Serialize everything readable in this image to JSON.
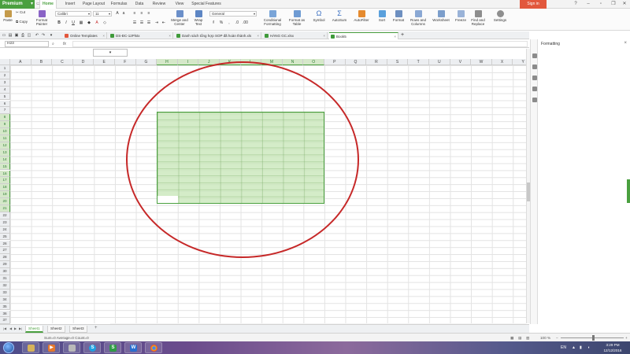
{
  "menubar": {
    "premium_label": "Premium",
    "tabs": [
      "Home",
      "Insert",
      "Page Layout",
      "Formulas",
      "Data",
      "Review",
      "View",
      "Special Features"
    ],
    "active_tab": "Home",
    "signin_label": "Sign in"
  },
  "ribbon": {
    "paste": "Paste",
    "cut": "Cut",
    "copy": "Copy",
    "format_painter": "Format Painter",
    "font_name": "Calibri",
    "font_size": "11",
    "merge_center": "Merge and Center",
    "wrap_text": "Wrap Text",
    "number_format": "General",
    "conditional_formatting": "Conditional Formatting",
    "format_as_table": "Format as Table",
    "symbol": "Symbol",
    "autosum": "AutoSum",
    "autofilter": "AutoFilter",
    "sort": "Sort",
    "format": "Format",
    "rows_columns": "Rows and Columns",
    "worksheet": "Worksheet",
    "freeze": "Freeze",
    "find_replace": "Find and Replace",
    "settings": "Settings"
  },
  "doc_tabs": [
    {
      "label": "Online Templates"
    },
    {
      "label": "DS-ĐC-12Plstx"
    },
    {
      "label": "Danh sách tổng hợp SOP đã hoàn thành.xls"
    },
    {
      "label": "HÀNG GC.xlsx"
    },
    {
      "label": "Book5"
    }
  ],
  "formula_bar": {
    "name_box": "H23",
    "fx": "fx",
    "value": ""
  },
  "grid": {
    "columns": [
      "A",
      "B",
      "C",
      "D",
      "E",
      "F",
      "G",
      "H",
      "I",
      "J",
      "K",
      "L",
      "M",
      "N",
      "O",
      "P",
      "Q",
      "R",
      "S",
      "T",
      "U",
      "V",
      "W",
      "X",
      "Y"
    ],
    "selected_columns": [
      "H",
      "I",
      "J",
      "K",
      "L",
      "M",
      "N",
      "O"
    ],
    "rows": [
      "1",
      "2",
      "3",
      "4",
      "5",
      "6",
      "7",
      "8",
      "9",
      "10",
      "11",
      "12",
      "13",
      "14",
      "15",
      "16",
      "17",
      "18",
      "19",
      "20",
      "21",
      "22",
      "23",
      "24",
      "25",
      "26",
      "27",
      "28",
      "29",
      "30",
      "31",
      "32",
      "33",
      "34",
      "35",
      "36",
      "37"
    ],
    "selected_rows": [
      "8",
      "9",
      "10",
      "11",
      "12",
      "13",
      "14",
      "15",
      "16",
      "17",
      "18",
      "19",
      "20",
      "21"
    ]
  },
  "sheets": {
    "tabs": [
      "Sheet1",
      "Sheet2",
      "Sheet3"
    ],
    "active": "Sheet1"
  },
  "statusbar": {
    "stats": "Sum=0   Average=0   Count=0",
    "zoom": "100 %"
  },
  "pane": {
    "title": "Formatting"
  },
  "taskbar": {
    "lang": "EN",
    "time": "3:29 PM",
    "date": "12/12/2016"
  },
  "colors": {
    "accent": "#4aa03f",
    "selection_fill": "#c6e6b6",
    "annotation": "#c62828",
    "signin": "#e2573c"
  }
}
